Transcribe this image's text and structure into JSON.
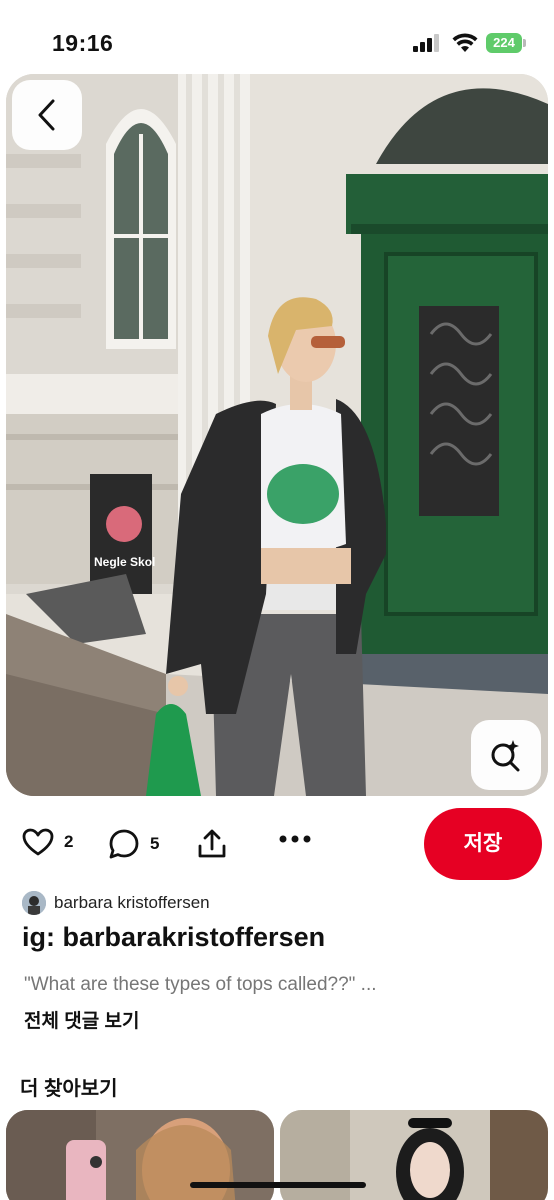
{
  "status_bar": {
    "time": "19:16",
    "battery": "224",
    "battery_color": "#5fcb6a"
  },
  "pin": {
    "likes": "2",
    "comments": "5",
    "save_label": "저장",
    "author": "barbara kristoffersen",
    "title": "ig: barbarakristoffersen",
    "comment_preview": "\"What are these types of tops called??\" ...",
    "view_all_comments": "전체 댓글 보기",
    "image_sign_text": "Negle Skol"
  },
  "more_to_explore": {
    "title": "더 찾아보기"
  },
  "colors": {
    "save_button": "#e60023",
    "door_green": "#1f5a33"
  },
  "icons": {
    "back": "chevron-left-icon",
    "visual_search": "lens-search-icon",
    "like": "heart-icon",
    "comment": "comment-bubble-icon",
    "share": "share-icon",
    "more": "ellipsis-icon"
  }
}
